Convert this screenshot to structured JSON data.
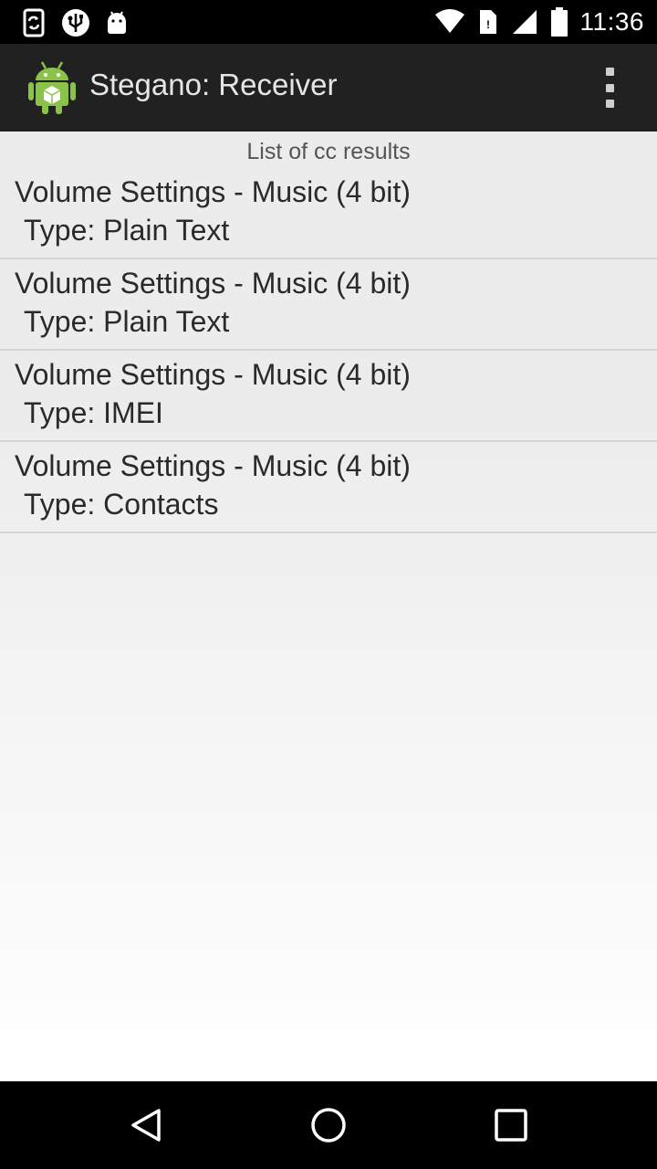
{
  "status_bar": {
    "time": "11:36",
    "left_icons": [
      "sync-phone-icon",
      "usb-globe-icon",
      "android-robot-icon"
    ],
    "right_icons": [
      "wifi-icon",
      "sim-icon",
      "signal-icon",
      "battery-icon"
    ]
  },
  "app_bar": {
    "title": "Stegano: Receiver",
    "icon": "android-app-icon",
    "menu_icon": "overflow-menu-icon"
  },
  "list": {
    "header": "List of cc results",
    "items": [
      {
        "title": "Volume Settings - Music (4 bit)",
        "type": "Type: Plain Text"
      },
      {
        "title": "Volume Settings - Music (4 bit)",
        "type": "Type: Plain Text"
      },
      {
        "title": "Volume Settings - Music (4 bit)",
        "type": "Type: IMEI"
      },
      {
        "title": "Volume Settings - Music (4 bit)",
        "type": "Type: Contacts"
      }
    ]
  },
  "nav_bar": {
    "buttons": [
      "back-icon",
      "home-icon",
      "recents-icon"
    ]
  },
  "colors": {
    "app_bar": "#212121",
    "status_bar": "#000000",
    "list_bg": "#ececec",
    "divider": "#d6d6d6"
  }
}
